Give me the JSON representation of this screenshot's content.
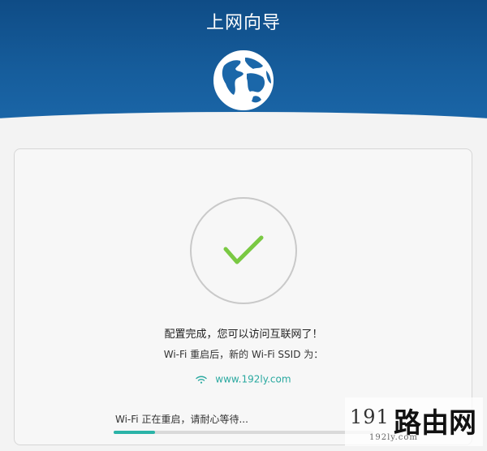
{
  "header": {
    "title": "上网向导"
  },
  "status": {
    "main_message": "配置完成，您可以访问互联网了！",
    "sub_message": "Wi-Fi 重启后，新的 Wi-Fi SSID 为：",
    "ssid": "www.192ly.com",
    "restart_message": "Wi-Fi 正在重启，请耐心等待...",
    "progress_fraction": 0.16
  },
  "watermark": {
    "number": "191",
    "name": "路由网",
    "site": "192ly.com"
  },
  "icons": {
    "globe": "globe-icon",
    "check": "checkmark-icon",
    "wifi": "wifi-icon"
  },
  "colors": {
    "header_blue": "#165d9c",
    "check_green": "#7ac943",
    "accent_teal": "#2ab3a7"
  }
}
